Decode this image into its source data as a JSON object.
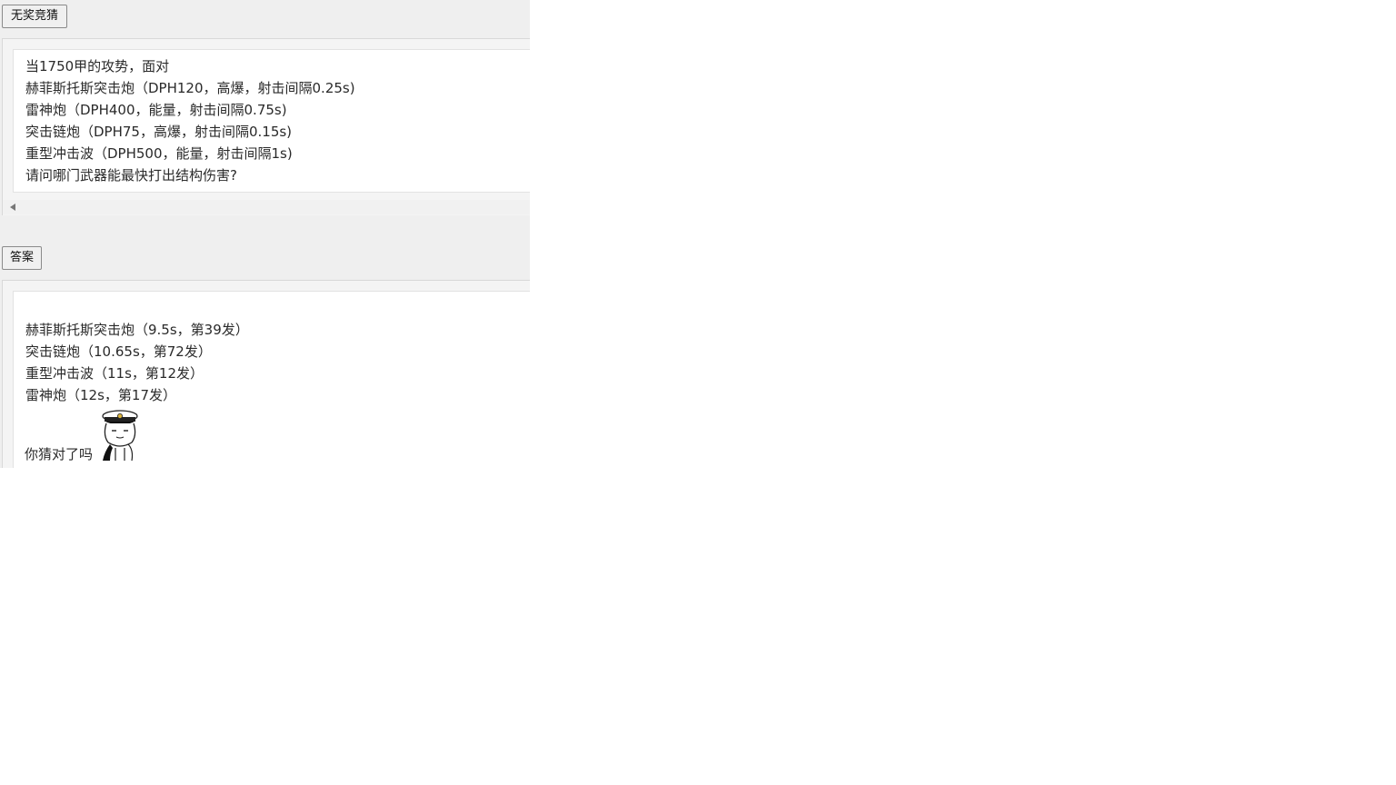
{
  "guess_button": {
    "label": "无奖竞猜"
  },
  "question": {
    "lines": [
      "当1750甲的攻势，面对",
      "赫菲斯托斯突击炮（DPH120，高爆，射击间隔0.25s)",
      "雷神炮（DPH400，能量，射击间隔0.75s)",
      "突击链炮（DPH75，高爆，射击间隔0.15s)",
      "重型冲击波（DPH500，能量，射击间隔1s)",
      "请问哪门武器能最快打出结构伤害?"
    ]
  },
  "answer_button": {
    "label": "答案"
  },
  "answer": {
    "lines": [
      "赫菲斯托斯突击炮（9.5s，第39发）",
      "突击链炮（10.65s，第72发）",
      "重型冲击波（11s，第12发）",
      "雷神炮（12s，第17发）"
    ],
    "closing": "你猜对了吗",
    "sticker_icon": "captain-meme-sticker-icon"
  }
}
